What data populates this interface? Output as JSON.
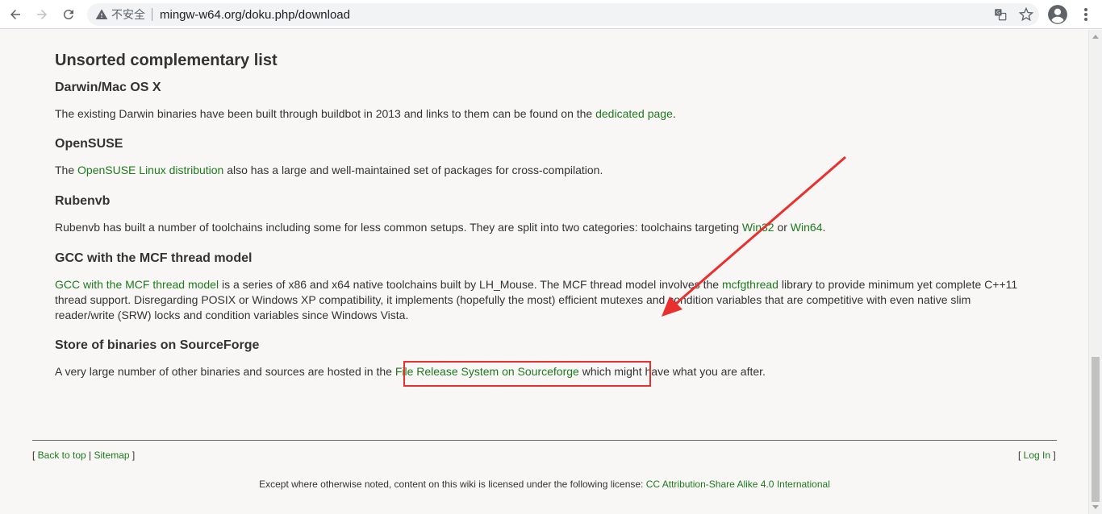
{
  "browser": {
    "insecure_label": "不安全",
    "url": "mingw-w64.org/doku.php/download"
  },
  "sections": {
    "main_heading": "Unsorted complementary list",
    "darwin": {
      "heading": "Darwin/Mac OS X",
      "text_before": "The existing Darwin binaries have been built through buildbot in 2013 and links to them can be found on the ",
      "link": "dedicated page",
      "text_after": "."
    },
    "opensuse": {
      "heading": "OpenSUSE",
      "text_before": "The ",
      "link": "OpenSUSE Linux distribution",
      "text_after": " also has a large and well-maintained set of packages for cross-compilation."
    },
    "rubenvb": {
      "heading": "Rubenvb",
      "text_before": "Rubenvb has built a number of toolchains including some for less common setups. They are split into two categories: toolchains targeting ",
      "link1": "Win32",
      "text_mid": " or ",
      "link2": "Win64",
      "text_after": "."
    },
    "mcf": {
      "heading": "GCC with the MCF thread model",
      "link1": "GCC with the MCF thread model",
      "text1": " is a series of x86 and x64 native toolchains built by LH_Mouse. The MCF thread model involves the ",
      "link2": "mcfgthread",
      "text2": " library to provide minimum yet complete C++11",
      "line2": "thread support. Disregarding POSIX or Windows XP compatibility, it implements (hopefully the most) efficient mutexes and condition variables that are competitive with even native slim",
      "line3": "reader/write (SRW) locks and condition variables since Windows Vista."
    },
    "sourceforge": {
      "heading": "Store of binaries on SourceForge",
      "text_before": "A very large number of other binaries and sources are hosted in the ",
      "link": "File Release System on Sourceforge",
      "text_after": " which might have what you are after."
    }
  },
  "footer": {
    "back_to_top": "Back to top",
    "sitemap": "Sitemap",
    "log_in": "Log In",
    "license_text": "Except where otherwise noted, content on this wiki is licensed under the following license: ",
    "license_link": "CC Attribution-Share Alike 4.0 International"
  },
  "colors": {
    "link": "#1d7a1d",
    "annotation": "#e8312e"
  }
}
